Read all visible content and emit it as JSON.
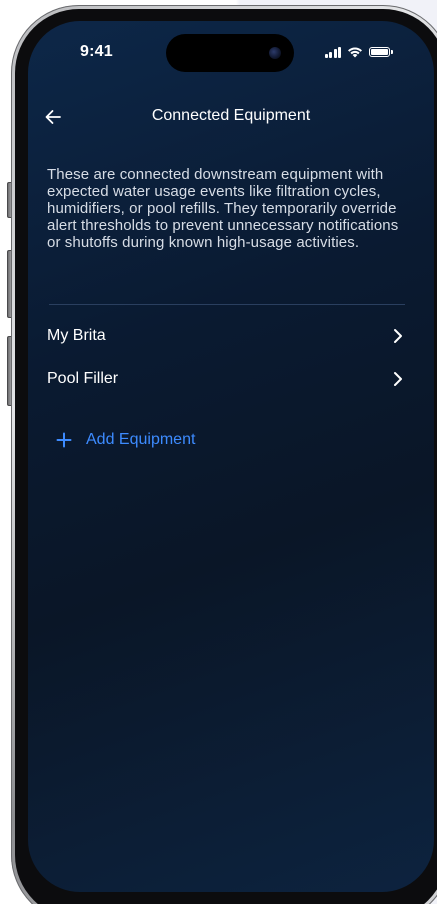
{
  "status_bar": {
    "time": "9:41",
    "icons": [
      "cellular-signal-icon",
      "wifi-icon",
      "battery-icon"
    ]
  },
  "nav": {
    "back_icon": "arrow-left-icon",
    "title": "Connected Equipment"
  },
  "description": "These are connected downstream equipment with expected water usage events like filtration cycles, humidifiers, or pool refills. They temporarily override alert thresholds to prevent unnecessary notifications or shutoffs during known high-usage activities.",
  "equipment": [
    {
      "label": "My Brita",
      "icon": "chevron-right-icon"
    },
    {
      "label": "Pool Filler",
      "icon": "chevron-right-icon"
    }
  ],
  "add_button": {
    "icon": "plus-icon",
    "label": "Add Equipment"
  },
  "colors": {
    "background": "#0a1a31",
    "accent": "#3d8bff",
    "text": "#ffffff",
    "secondary_text": "#d7dde6"
  }
}
